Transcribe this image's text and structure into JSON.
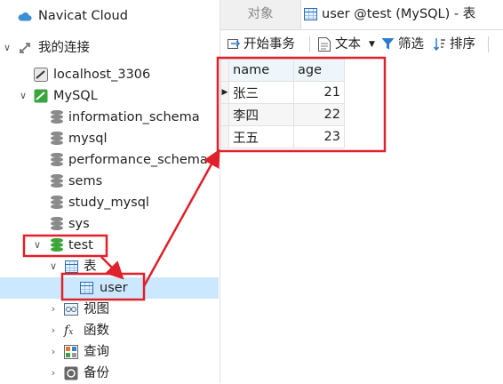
{
  "navigator": {
    "title": "Navicat Cloud",
    "section": "我的连接",
    "items": [
      {
        "label": "localhost_3306"
      },
      {
        "label": "MySQL"
      },
      {
        "label": "information_schema"
      },
      {
        "label": "mysql"
      },
      {
        "label": "performance_schema"
      },
      {
        "label": "sems"
      },
      {
        "label": "study_mysql"
      },
      {
        "label": "sys"
      },
      {
        "label": "test"
      },
      {
        "label": "表"
      },
      {
        "label": "user"
      },
      {
        "label": "视图"
      },
      {
        "label": "函数"
      },
      {
        "label": "查询"
      },
      {
        "label": "备份"
      }
    ]
  },
  "tabs": [
    {
      "label": "对象"
    },
    {
      "label": "user @test (MySQL) - 表"
    }
  ],
  "toolbar": {
    "begin_transaction": "开始事务",
    "text": "文本",
    "filter": "筛选",
    "sort": "排序"
  },
  "grid": {
    "columns": [
      "name",
      "age"
    ],
    "rows": [
      {
        "name": "张三",
        "age": "21"
      },
      {
        "name": "李四",
        "age": "22"
      },
      {
        "name": "王五",
        "age": "23"
      }
    ]
  },
  "colors": {
    "annotation": "#e0202a",
    "selection": "#cce8ff",
    "db_active": "#3aa53a"
  }
}
